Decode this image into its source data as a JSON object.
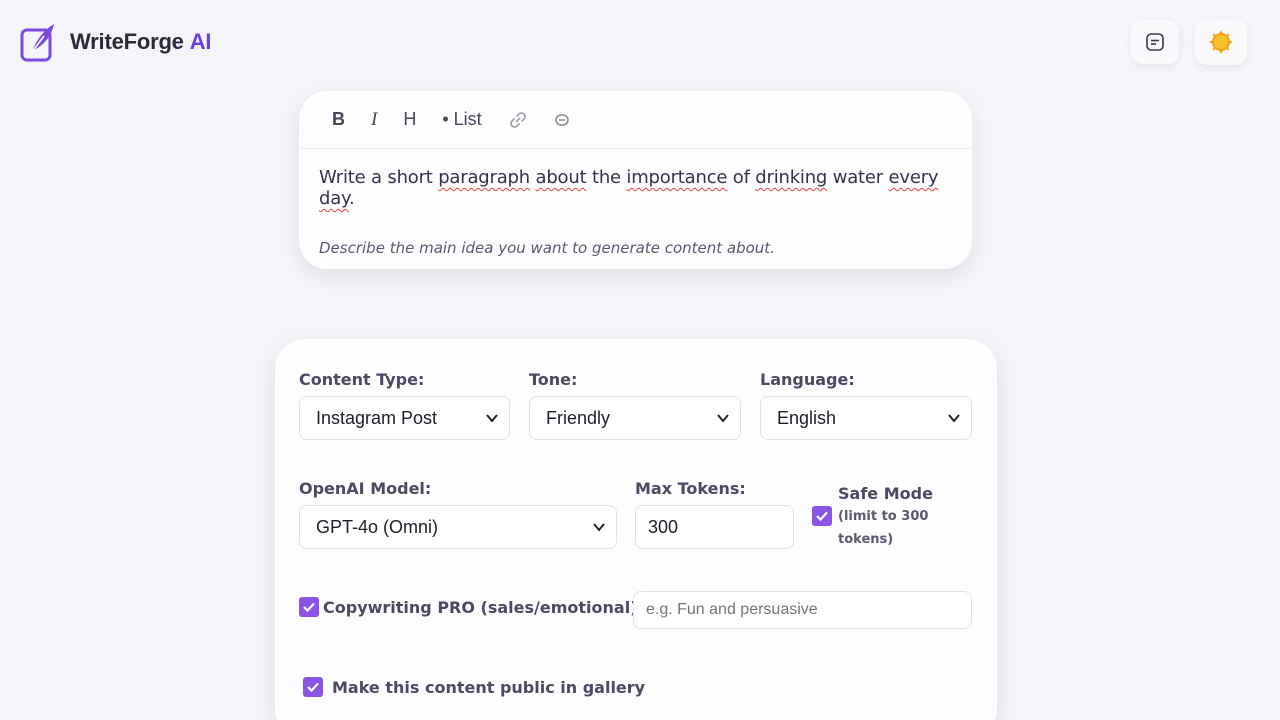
{
  "brand": {
    "name": "WriteForge",
    "ai": "AI"
  },
  "header": {
    "history_icon": "notes-icon",
    "theme_icon": "sun-icon"
  },
  "editor": {
    "toolbar": {
      "bold": "B",
      "italic": "I",
      "heading": "H",
      "list": "• List",
      "link_icon": "link-icon",
      "unlink_icon": "unlink-icon"
    },
    "prompt_words": [
      "Write a short ",
      "paragraph",
      " ",
      "about",
      " the ",
      "importance",
      " of ",
      "drinking",
      " water ",
      "every",
      " ",
      "day",
      "."
    ],
    "hint": "Describe the main idea you want to generate content about."
  },
  "settings": {
    "content_type": {
      "label": "Content Type:",
      "value": "Instagram Post"
    },
    "tone": {
      "label": "Tone:",
      "value": "Friendly"
    },
    "language": {
      "label": "Language:",
      "value": "English"
    },
    "model": {
      "label": "OpenAI Model:",
      "value": "GPT-4o (Omni)"
    },
    "max_tokens": {
      "label": "Max Tokens:",
      "value": "300"
    },
    "safe_mode": {
      "label": "Safe Mode",
      "sub1": "(limit to 300",
      "sub2": "tokens)",
      "checked": true
    },
    "copywriting": {
      "label": "Copywriting PRO (sales/emotional)",
      "checked": true,
      "placeholder": "e.g. Fun and persuasive"
    },
    "public": {
      "label": "Make this content public in gallery",
      "checked": true
    }
  },
  "colors": {
    "accent": "#8a55e6",
    "brand_ai": "#6d3fe0",
    "background": "#f5f5f9"
  }
}
